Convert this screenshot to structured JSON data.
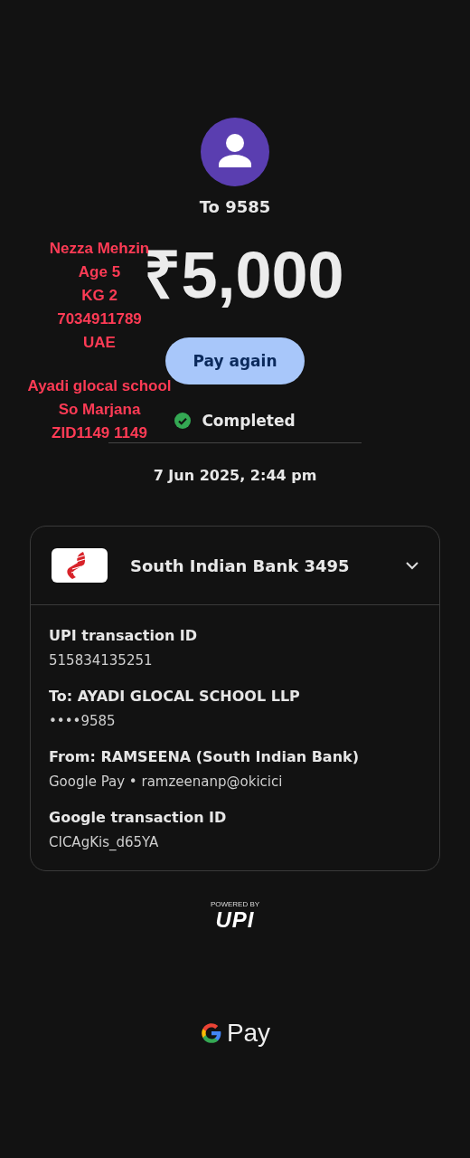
{
  "recipient": {
    "title": "To 9585"
  },
  "amount": "₹5,000",
  "annotation": {
    "groups": [
      [
        "Nezza Mehzin",
        "Age 5",
        "KG 2",
        "7034911789",
        "UAE"
      ],
      [
        "Ayadi glocal school",
        "So Marjana",
        "ZID1149 1149"
      ]
    ],
    "color": "#ff3b55"
  },
  "pay_again_button": "Pay again",
  "status": {
    "label": "Completed",
    "completed": true
  },
  "date": "7 Jun 2025, 2:44 pm",
  "details_card": {
    "bank": "South Indian Bank 3495",
    "expanded": true,
    "fields": [
      {
        "label": "UPI transaction ID",
        "value": "515834135251"
      },
      {
        "label": "To: AYADI GLOCAL SCHOOL LLP",
        "value": "••••9585"
      },
      {
        "label": "From: RAMSEENA (South Indian Bank)",
        "value": "Google Pay • ramzeenanp@okicici"
      },
      {
        "label": "Google transaction ID",
        "value": "CICAgKis_d65YA"
      }
    ]
  },
  "upi_badge": {
    "caption": "POWERED BY",
    "logo": "UPI"
  },
  "footer": {
    "brand": "Pay"
  }
}
